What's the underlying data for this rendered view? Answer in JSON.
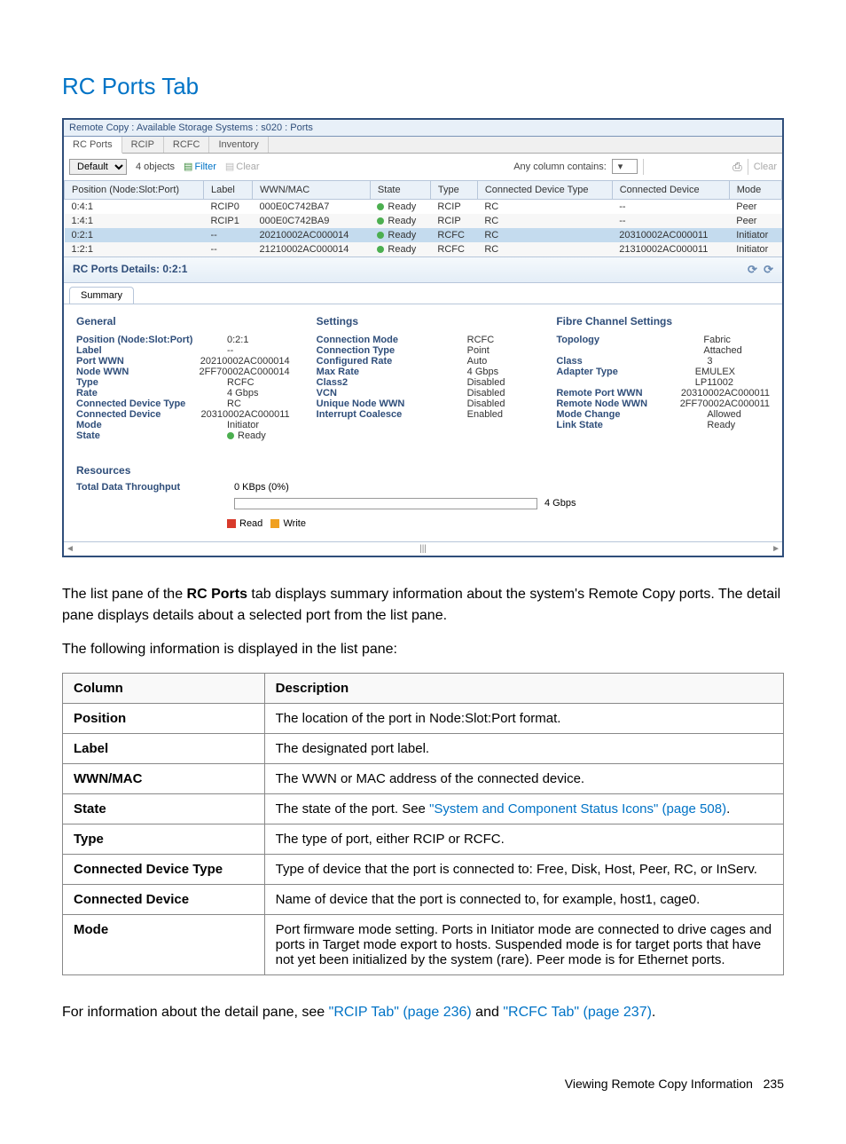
{
  "page_heading": "RC Ports Tab",
  "screenshot": {
    "title": "Remote Copy : Available Storage Systems : s020 : Ports",
    "tabs": [
      "RC Ports",
      "RCIP",
      "RCFC",
      "Inventory"
    ],
    "toolbar": {
      "default_label": "Default",
      "objects_label": "4 objects",
      "filter_label": "Filter",
      "clear_label": "Clear",
      "any_column_label": "Any column contains:",
      "clear2_label": "Clear"
    },
    "list_headers": [
      "Position (Node:Slot:Port)",
      "Label",
      "WWN/MAC",
      "State",
      "Type",
      "Connected Device Type",
      "Connected Device",
      "Mode"
    ],
    "list_rows": [
      {
        "pos": "0:4:1",
        "label": "RCIP0",
        "wwn": "000E0C742BA7",
        "state": "Ready",
        "type": "RCIP",
        "cdt": "RC",
        "cd": "--",
        "mode": "Peer",
        "selected": false
      },
      {
        "pos": "1:4:1",
        "label": "RCIP1",
        "wwn": "000E0C742BA9",
        "state": "Ready",
        "type": "RCIP",
        "cdt": "RC",
        "cd": "--",
        "mode": "Peer",
        "selected": false
      },
      {
        "pos": "0:2:1",
        "label": "--",
        "wwn": "20210002AC000014",
        "state": "Ready",
        "type": "RCFC",
        "cdt": "RC",
        "cd": "20310002AC000011",
        "mode": "Initiator",
        "selected": true
      },
      {
        "pos": "1:2:1",
        "label": "--",
        "wwn": "21210002AC000014",
        "state": "Ready",
        "type": "RCFC",
        "cdt": "RC",
        "cd": "21310002AC000011",
        "mode": "Initiator",
        "selected": false
      }
    ],
    "details_header": "RC Ports Details: 0:2:1",
    "subtab": "Summary",
    "general": {
      "title": "General",
      "rows": [
        {
          "k": "Position (Node:Slot:Port)",
          "v": "0:2:1",
          "link": true
        },
        {
          "k": "Label",
          "v": "--"
        },
        {
          "k": "Port WWN",
          "v": "20210002AC000014",
          "link": true
        },
        {
          "k": "Node WWN",
          "v": "2FF70002AC000014",
          "link": true
        },
        {
          "k": "Type",
          "v": "RCFC"
        },
        {
          "k": "Rate",
          "v": "4 Gbps"
        },
        {
          "k": "Connected Device Type",
          "v": "RC"
        },
        {
          "k": "Connected Device",
          "v": "20310002AC000011",
          "link": true
        },
        {
          "k": "Mode",
          "v": "Initiator"
        },
        {
          "k": "State",
          "v": "Ready",
          "dot": true
        }
      ]
    },
    "settings": {
      "title": "Settings",
      "rows": [
        {
          "k": "Connection Mode",
          "v": "RCFC"
        },
        {
          "k": "Connection Type",
          "v": "Point"
        },
        {
          "k": "Configured Rate",
          "v": "Auto"
        },
        {
          "k": "Max Rate",
          "v": "4 Gbps"
        },
        {
          "k": "Class2",
          "v": "Disabled"
        },
        {
          "k": "VCN",
          "v": "Disabled"
        },
        {
          "k": "Unique Node WWN",
          "v": "Disabled"
        },
        {
          "k": "Interrupt Coalesce",
          "v": "Enabled"
        }
      ]
    },
    "fibre": {
      "title": "Fibre Channel Settings",
      "rows": [
        {
          "k": "Topology",
          "v": "Fabric Attached"
        },
        {
          "k": "Class",
          "v": "3"
        },
        {
          "k": "Adapter Type",
          "v": "EMULEX LP11002"
        },
        {
          "k": "Remote Port WWN",
          "v": "20310002AC000011",
          "link": true
        },
        {
          "k": "Remote Node WWN",
          "v": "2FF70002AC000011",
          "link": true
        },
        {
          "k": "Mode Change",
          "v": "Allowed"
        },
        {
          "k": "Link State",
          "v": "Ready"
        }
      ]
    },
    "resources": {
      "title": "Resources",
      "throughput_label": "Total Data Throughput",
      "throughput_value": "0 KBps (0%)",
      "bar_max": "4 Gbps",
      "legend_read": "Read",
      "legend_write": "Write"
    }
  },
  "para1_prefix": "The list pane of the ",
  "para1_bold": "RC Ports",
  "para1_suffix": " tab displays summary information about the system's Remote Copy ports. The detail pane displays details about a selected port from the list pane.",
  "para2": "The following information is displayed in the list pane:",
  "desc_table": {
    "headers": [
      "Column",
      "Description"
    ],
    "rows": [
      {
        "col": "Position",
        "desc": "The location of the port in Node:Slot:Port format."
      },
      {
        "col": "Label",
        "desc": "The designated port label."
      },
      {
        "col": "WWN/MAC",
        "desc": "The WWN or MAC address of the connected device."
      },
      {
        "col": "State",
        "desc_prefix": "The state of the port. See ",
        "link": "\"System and Component Status Icons\" (page 508)",
        "desc_suffix": "."
      },
      {
        "col": "Type",
        "desc": "The type of port, either RCIP or RCFC."
      },
      {
        "col": "Connected Device Type",
        "desc": "Type of device that the port is connected to: Free, Disk, Host, Peer, RC, or InServ."
      },
      {
        "col": "Connected Device",
        "desc": "Name of device that the port is connected to, for example, host1, cage0."
      },
      {
        "col": "Mode",
        "desc": "Port firmware mode setting. Ports in Initiator mode are connected to drive cages and ports in Target mode export to hosts. Suspended mode is for target ports that have not yet been initialized by the system (rare). Peer mode is for Ethernet ports."
      }
    ]
  },
  "para3_prefix": "For information about the detail pane, see ",
  "para3_link1": "\"RCIP Tab\" (page 236)",
  "para3_mid": " and ",
  "para3_link2": "\"RCFC Tab\" (page 237)",
  "para3_suffix": ".",
  "footer_label": "Viewing Remote Copy Information",
  "footer_page": "235"
}
